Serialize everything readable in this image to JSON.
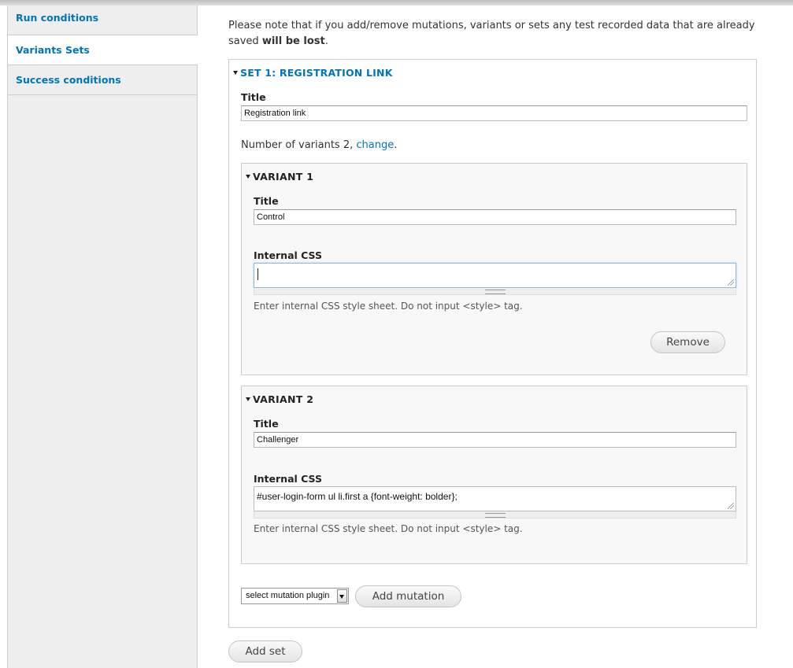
{
  "vertical_tabs": [
    {
      "label": "Run conditions",
      "selected": false
    },
    {
      "label": "Variants Sets",
      "selected": true
    },
    {
      "label": "Success conditions",
      "selected": false
    }
  ],
  "notice": {
    "text_before": "Please note that if you add/remove mutations, variants or sets any test recorded data that are already saved ",
    "bold": "will be lost",
    "text_after": "."
  },
  "set": {
    "legend": "SET 1: REGISTRATION LINK",
    "title_label": "Title",
    "title_value": "Registration link",
    "variants_count_text": "Number of variants 2, ",
    "change_link": "change",
    "variants_count_end": ".",
    "variants": [
      {
        "legend": "VARIANT 1",
        "title_label": "Title",
        "title_value": "Control",
        "css_label": "Internal CSS",
        "css_value": "",
        "css_description": "Enter internal CSS style sheet. Do not input <style> tag.",
        "remove_button": "Remove"
      },
      {
        "legend": "VARIANT 2",
        "title_label": "Title",
        "title_value": "Challenger",
        "css_label": "Internal CSS",
        "css_value": "#user-login-form ul li.first a {font-weight: bolder};",
        "css_description": "Enter internal CSS style sheet. Do not input <style> tag."
      }
    ],
    "mutation_select": "select mutation plugin",
    "add_mutation_button": "Add mutation"
  },
  "add_set_button": "Add set",
  "colors": {
    "link": "#0074bd",
    "tab_bg": "#eeeeee",
    "border": "#cccccc"
  }
}
